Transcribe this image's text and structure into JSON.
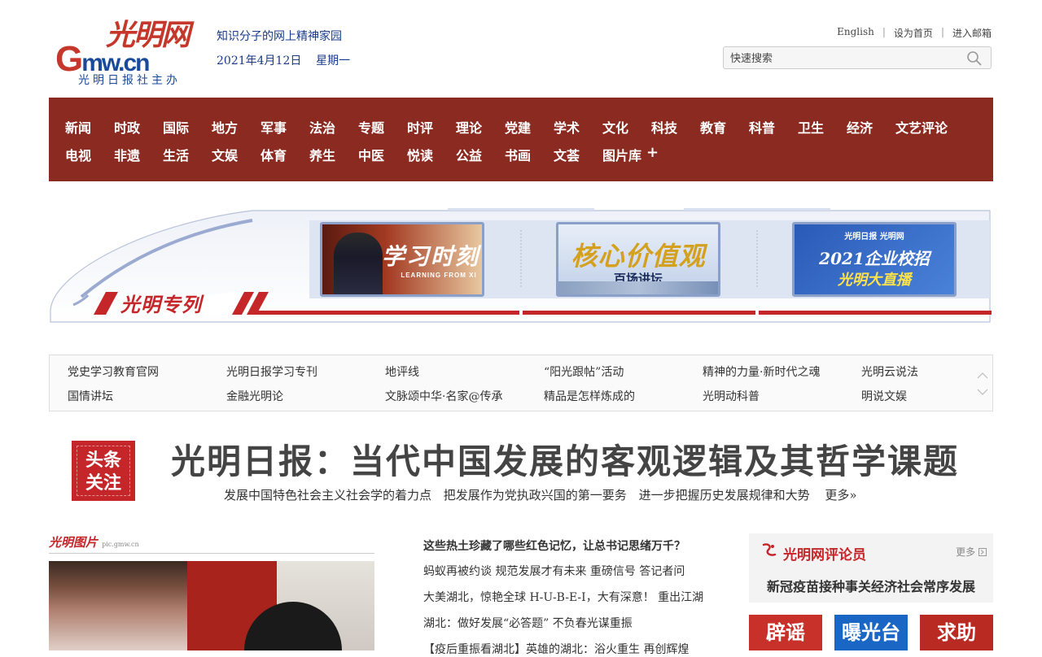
{
  "header": {
    "logo_brush": "光明网",
    "logo_g": "G",
    "logo_domain": "mw.cn",
    "logo_sub": "光明日报社主办",
    "slogan": "知识分子的网上精神家园",
    "date": "2021年4月12日",
    "weekday": "星期一",
    "links": [
      "English",
      "设为首页",
      "进入邮箱"
    ],
    "search_placeholder": "快速搜索"
  },
  "nav": {
    "row1": [
      "新闻",
      "时政",
      "国际",
      "地方",
      "军事",
      "法治",
      "专题",
      "时评",
      "理论",
      "党建",
      "学术",
      "文化",
      "科技",
      "教育",
      "科普",
      "卫生",
      "经济",
      "文艺评论"
    ],
    "row2": [
      "电视",
      "非遗",
      "生活",
      "文娱",
      "体育",
      "养生",
      "中医",
      "悦读",
      "公益",
      "书画",
      "文荟",
      "图片库"
    ],
    "more_symbol": "+"
  },
  "train": {
    "label": "光明专列",
    "tiles": [
      {
        "title": "学习时刻",
        "subtitle": "LEARNING FROM XI"
      },
      {
        "title": "核心价值观",
        "subtitle": "百场讲坛"
      },
      {
        "title": "2021企业校招",
        "subtitle": "光明大直播",
        "brand": "光明日报 光明网"
      }
    ]
  },
  "link_box": {
    "row1": [
      "党史学习教育官网",
      "光明日报学习专刊",
      "地评线",
      "“阳光跟帖”活动",
      "精神的力量·新时代之魂",
      "光明云说法"
    ],
    "row2": [
      "国情讲坛",
      "金融光明论",
      "文脉颂中华·名家@传承",
      "精品是怎样炼成的",
      "光明动科普",
      "明说文娱"
    ]
  },
  "headline": {
    "badge": [
      "头条",
      "关注"
    ],
    "title": "光明日报：当代中国发展的客观逻辑及其哲学课题",
    "subs": [
      "发展中国特色社会主义社会学的着力点",
      "把发展作为党执政兴国的第一要务",
      "进一步把握历史发展规律和大势"
    ],
    "more": "更多»"
  },
  "pictures": {
    "logo": "光明图片",
    "logo_sub": "pic.gmw.cn"
  },
  "news": [
    "这些热土珍藏了哪些红色记忆，让总书记思绪万千？",
    "蚂蚁再被约谈 规范发展才有未来 重磅信号 答记者问",
    "大美湖北，惊艳全球 H-U-B-E-I，大有深意！ 重出江湖",
    "湖北：做好发展“必答题” 不负春光谋重振",
    "【疫后重振看湖北】英雄的湖北：浴火重生 再创辉煌"
  ],
  "commentator": {
    "title": "光明网评论员",
    "more": "更多",
    "headline": "新冠疫苗接种事关经济社会常序发展"
  },
  "buttons": [
    "辟谣",
    "曝光台",
    "求助"
  ],
  "colors": {
    "nav_bg": "#8b2a20",
    "brand_red": "#c4262a",
    "brand_blue": "#1a4a9a"
  }
}
